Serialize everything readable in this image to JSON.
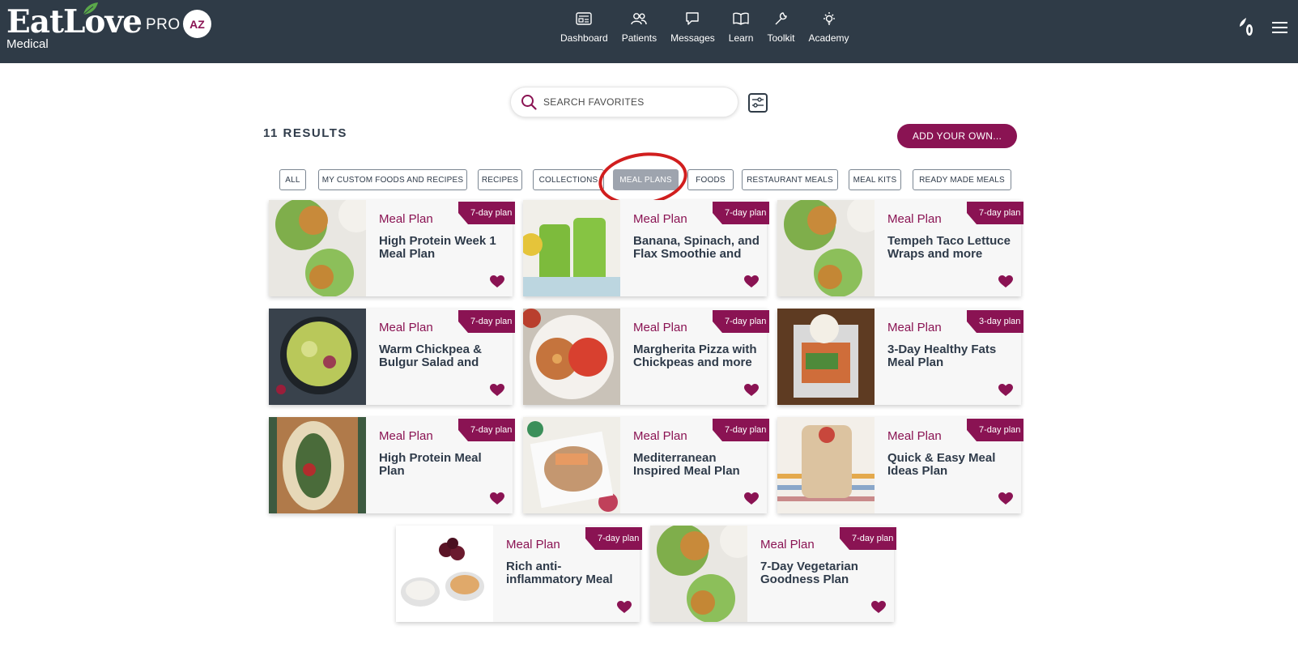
{
  "header": {
    "logo": "EatLove",
    "logo_sub": "Medical",
    "pro_label": "PRO",
    "avatar_initials": "AZ",
    "nav": [
      {
        "label": "Dashboard",
        "icon": "dashboard-icon"
      },
      {
        "label": "Patients",
        "icon": "patients-icon"
      },
      {
        "label": "Messages",
        "icon": "messages-icon"
      },
      {
        "label": "Learn",
        "icon": "learn-icon"
      },
      {
        "label": "Toolkit",
        "icon": "toolkit-icon"
      },
      {
        "label": "Academy",
        "icon": "academy-icon"
      }
    ]
  },
  "search": {
    "placeholder": "SEARCH FAVORITES"
  },
  "results_label": "11 RESULTS",
  "add_button": "ADD YOUR OWN...",
  "filters": [
    "ALL",
    "MY CUSTOM FOODS AND RECIPES",
    "RECIPES",
    "COLLECTIONS",
    "MEAL PLANS",
    "FOODS",
    "RESTAURANT MEALS",
    "MEAL KITS",
    "READY MADE MEALS"
  ],
  "active_filter": "MEAL PLANS",
  "cards": [
    {
      "type": "Meal Plan",
      "title": "High Protein Week 1 Meal Plan",
      "ribbon": "7-day plan"
    },
    {
      "type": "Meal Plan",
      "title": "Banana, Spinach, and Flax Smoothie and",
      "ribbon": "7-day plan"
    },
    {
      "type": "Meal Plan",
      "title": "Tempeh Taco Lettuce Wraps and more",
      "ribbon": "7-day plan"
    },
    {
      "type": "Meal Plan",
      "title": "Warm Chickpea & Bulgur Salad and more",
      "ribbon": "7-day plan"
    },
    {
      "type": "Meal Plan",
      "title": "Margherita Pizza with Chickpeas and more",
      "ribbon": "7-day plan"
    },
    {
      "type": "Meal Plan",
      "title": "3-Day Healthy Fats Meal Plan",
      "ribbon": "3-day plan"
    },
    {
      "type": "Meal Plan",
      "title": "High Protein Meal Plan",
      "ribbon": "7-day plan"
    },
    {
      "type": "Meal Plan",
      "title": "Mediterranean Inspired Meal Plan",
      "ribbon": "7-day plan"
    },
    {
      "type": "Meal Plan",
      "title": "Quick & Easy Meal Ideas Plan",
      "ribbon": "7-day plan"
    },
    {
      "type": "Meal Plan",
      "title": "Rich anti-inflammatory Meal",
      "ribbon": "7-day plan"
    },
    {
      "type": "Meal Plan",
      "title": "7-Day Vegetarian Goodness Plan",
      "ribbon": "7-day plan"
    }
  ],
  "colors": {
    "brand": "#8a1353",
    "header_bg": "#2f3b47",
    "active_tab": "#9ea4ae"
  }
}
